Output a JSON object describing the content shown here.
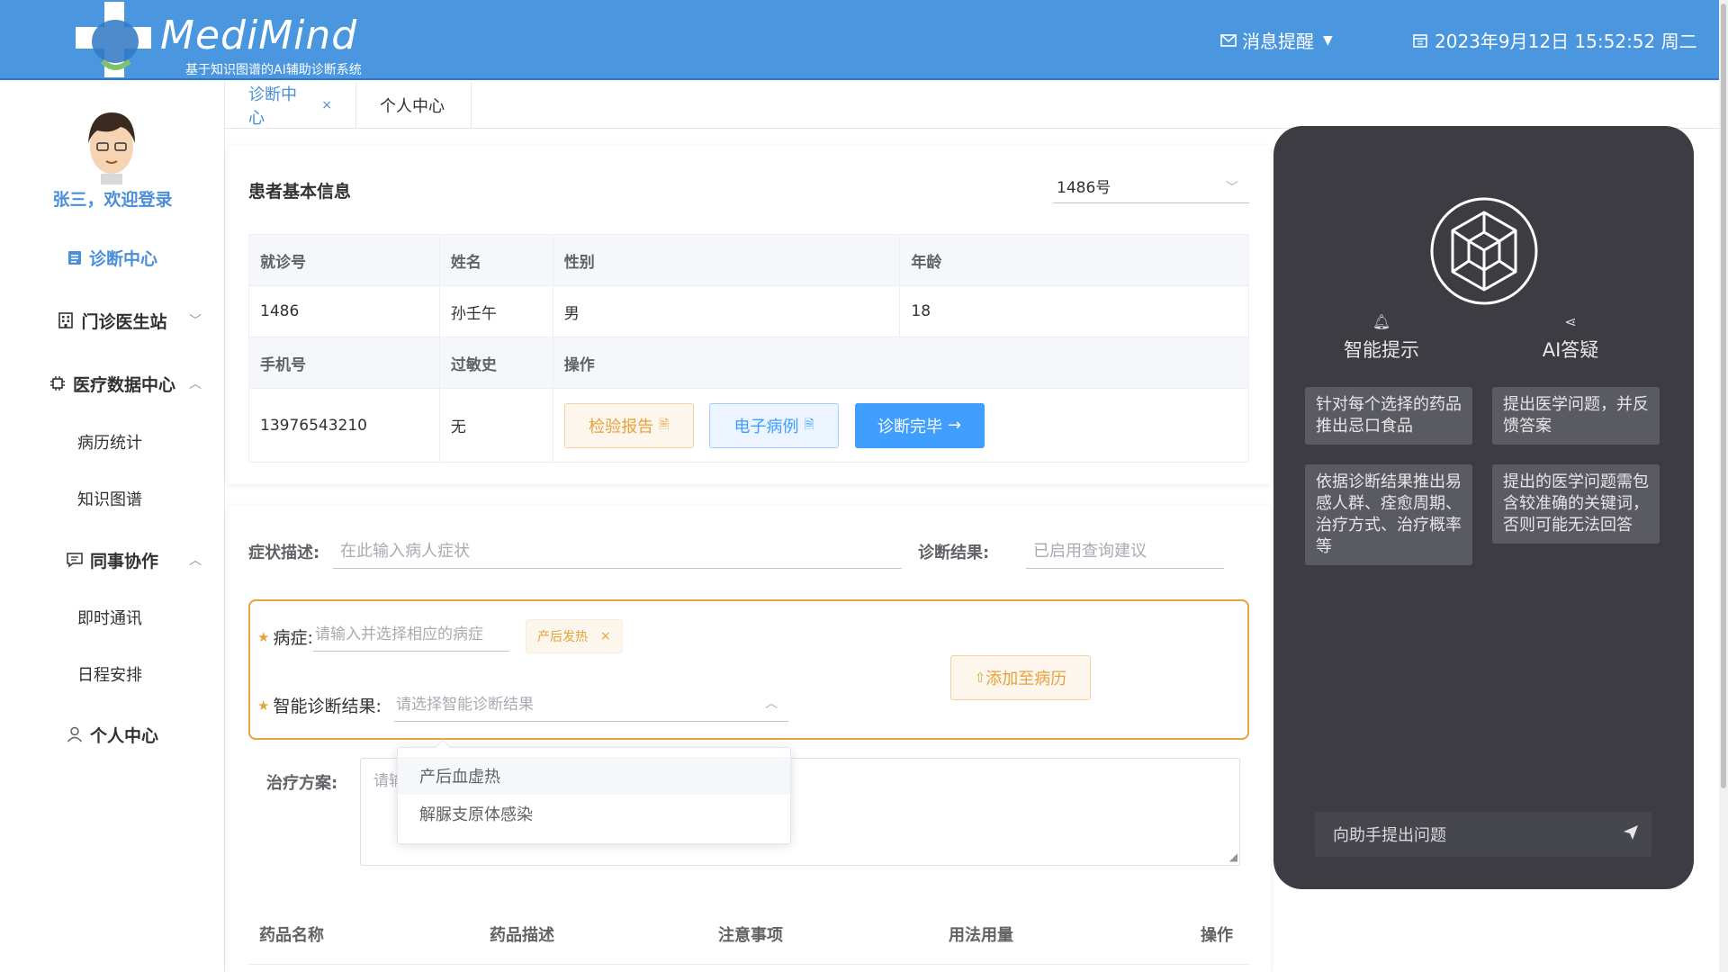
{
  "header": {
    "brand": "MediMind",
    "subtitle": "基于知识图谱的AI辅助诊断系统",
    "notifications": "消息提醒",
    "datetime": "2023年9月12日 15:52:52 周二"
  },
  "sidebar": {
    "welcome": "张三，欢迎登录",
    "items": [
      {
        "label": "诊断中心",
        "icon": "clipboard-icon"
      },
      {
        "label": "门诊医生站",
        "icon": "building-icon"
      },
      {
        "label": "医疗数据中心",
        "icon": "chip-icon"
      },
      {
        "label": "病历统计"
      },
      {
        "label": "知识图谱"
      },
      {
        "label": "同事协作",
        "icon": "chat-icon"
      },
      {
        "label": "即时通讯"
      },
      {
        "label": "日程安排"
      },
      {
        "label": "个人中心",
        "icon": "user-icon"
      }
    ]
  },
  "tabs": [
    {
      "label": "诊断中心",
      "close": "×"
    },
    {
      "label": "个人中心"
    }
  ],
  "patient": {
    "title": "患者基本信息",
    "select_value": "1486号",
    "headers1": [
      "就诊号",
      "姓名",
      "性别",
      "年龄"
    ],
    "row1": [
      "1486",
      "孙壬午",
      "男",
      "18"
    ],
    "headers2": [
      "手机号",
      "过敏史",
      "操作"
    ],
    "row2": [
      "13976543210",
      "无"
    ],
    "buttons": {
      "report": "检验报告",
      "emr": "电子病例",
      "done": "诊断完毕"
    }
  },
  "diagnosis": {
    "symptom_label": "症状描述:",
    "symptom_placeholder": "在此输入病人症状",
    "result_label": "诊断结果:",
    "result_placeholder": "已启用查询建议",
    "disease_label": "病症:",
    "disease_placeholder": "请输入并选择相应的病症",
    "disease_tag": "产后发热",
    "ai_label": "智能诊断结果:",
    "ai_placeholder": "请选择智能诊断结果",
    "add_button": "添加至病历",
    "treatment_label": "治疗方案:",
    "treatment_placeholder": "请输",
    "dropdown_options": [
      "产后血虚热",
      "解脲支原体感染"
    ]
  },
  "drug_table": {
    "headers": [
      "药品名称",
      "药品描述",
      "注意事项",
      "用法用量",
      "操作"
    ]
  },
  "ai_panel": {
    "tab_hint": "智能提示",
    "tab_qa": "AI答疑",
    "cards": [
      "针对每个选择的药品推出忌口食品",
      "提出医学问题，并反馈答案",
      "依据诊断结果推出易感人群、痊愈周期、治疗方式、治疗概率等",
      "提出的医学问题需包含较准确的关键词，否则可能无法回答"
    ],
    "input_placeholder": "向助手提出问题"
  },
  "colors": {
    "header_bg": "#4a97df",
    "accent": "#409eff",
    "warning": "#e6a23c",
    "ai_panel_bg": "#3c3c42"
  }
}
